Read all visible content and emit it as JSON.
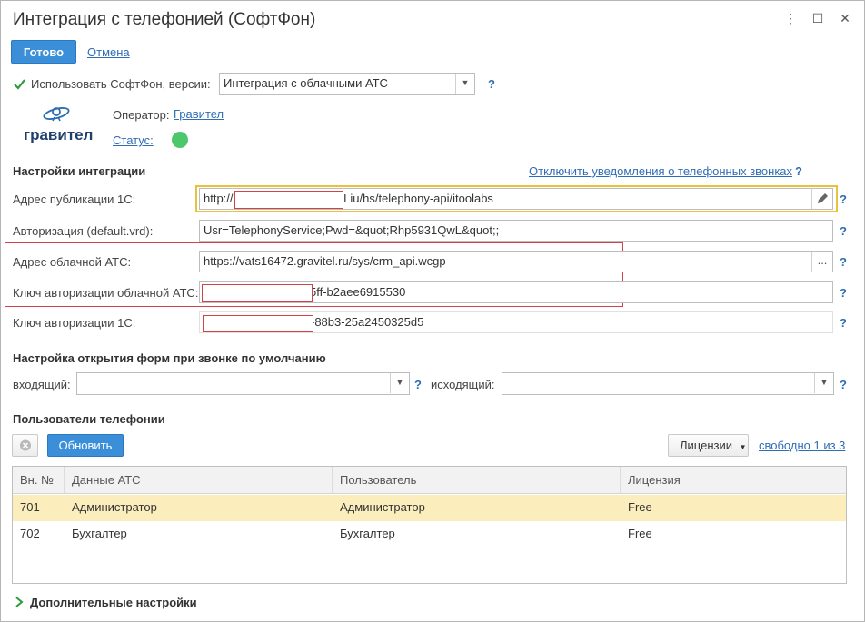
{
  "window": {
    "title": "Интеграция с телефонией (СофтФон)",
    "more": "⋮",
    "maximize": "☐",
    "close": "✕"
  },
  "toolbar": {
    "ok_label": "Готово",
    "cancel_label": "Отмена"
  },
  "softphone": {
    "checkbox_label": "Использовать СофтФон, версии:",
    "checked": true,
    "version_value": "Интеграция с облачными АТС",
    "help": "?"
  },
  "operator": {
    "logo_text": "гравител",
    "operator_label": "Оператор:",
    "operator_link": "Гравител",
    "status_link": "Статус:",
    "status_color": "#4cc76a"
  },
  "integration": {
    "section_title": "Настройки интеграции",
    "disable_notifications_link": "Отключить уведомления о телефонных звонках",
    "help": "?",
    "fields": [
      {
        "label": "Адрес публикации 1С:",
        "value_prefix": "http://",
        "value_suffix": "/Liu/hs/telephony-api/itoolabs"
      },
      {
        "label": "Авторизация (default.vrd):",
        "value": "Usr=TelephonyService;Pwd=&quot;Rhp5931QwL&quot;;"
      },
      {
        "label": "Адрес облачной АТС:",
        "value": "https://vats16472.gravitel.ru/sys/crm_api.wcgp",
        "button": "..."
      },
      {
        "label": "Ключ авторизации облачной АТС:",
        "value_suffix": "5ff-b2aee6915530"
      },
      {
        "label": "Ключ авторизации 1С:",
        "value_suffix": "-88b3-25a2450325d5"
      }
    ]
  },
  "forms": {
    "section_title": "Настройка открытия форм при звонке по умолчанию",
    "incoming_label": "входящий:",
    "incoming_value": "",
    "outgoing_label": "исходящий:",
    "outgoing_value": "",
    "help": "?"
  },
  "users": {
    "section_title": "Пользователи телефонии",
    "refresh_label": "Обновить",
    "licenses_label": "Лицензии",
    "free_link": "свободно 1 из 3",
    "columns": [
      "Вн. №",
      "Данные АТС",
      "Пользователь",
      "Лицензия"
    ],
    "rows": [
      [
        "701",
        "Администратор",
        "Администратор",
        "Free"
      ],
      [
        "702",
        "Бухгалтер",
        "Бухгалтер",
        "Free"
      ]
    ]
  },
  "more_settings": {
    "label": "Дополнительные настройки"
  },
  "colors": {
    "accent": "#3b8fd9",
    "highlight_border": "#e8c23a",
    "redact_border": "#d0434b",
    "selected_row": "#fbeebc"
  }
}
